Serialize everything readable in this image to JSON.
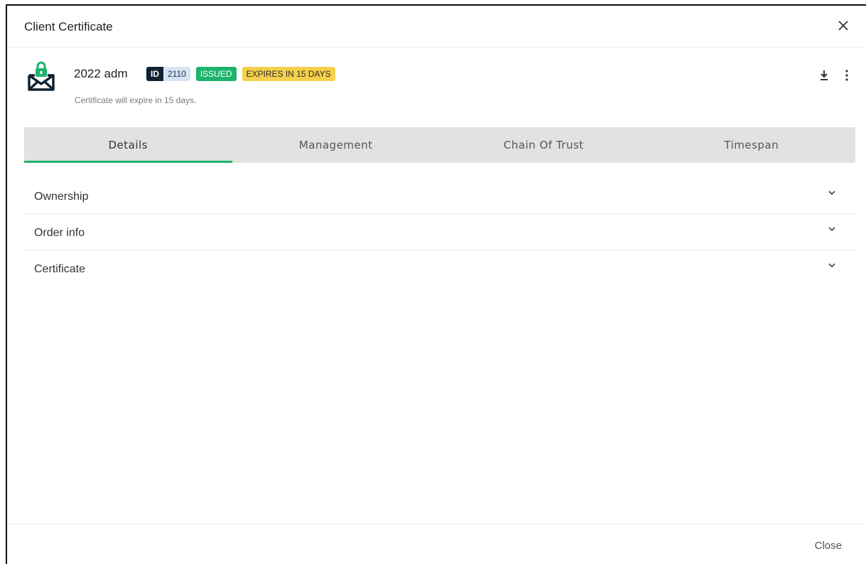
{
  "dialog": {
    "title": "Client Certificate",
    "close_icon": "close-icon"
  },
  "certificate": {
    "icon": "envelope-lock-icon",
    "name": "2022 adm",
    "id_label": "ID",
    "id_value": "2110",
    "status": "ISSUED",
    "expiry_badge": "EXPIRES IN 15 DAYS",
    "subtitle": "Certificate will expire in 15 days.",
    "actions": [
      "download-icon",
      "more-vert-icon"
    ]
  },
  "tabs": [
    {
      "label": "Details",
      "active": true
    },
    {
      "label": "Management",
      "active": false
    },
    {
      "label": "Chain Of Trust",
      "active": false
    },
    {
      "label": "Timespan",
      "active": false
    }
  ],
  "sections": [
    {
      "label": "Ownership",
      "icon": "chevron-down-icon"
    },
    {
      "label": "Order info",
      "icon": "chevron-down-icon"
    },
    {
      "label": "Certificate",
      "icon": "chevron-down-icon"
    }
  ],
  "footer": {
    "close_label": "Close"
  },
  "colors": {
    "accent": "#1db36b",
    "expiry": "#f5d04b",
    "id_dark": "#0f2233",
    "tab_bg": "#e2e2e2"
  }
}
